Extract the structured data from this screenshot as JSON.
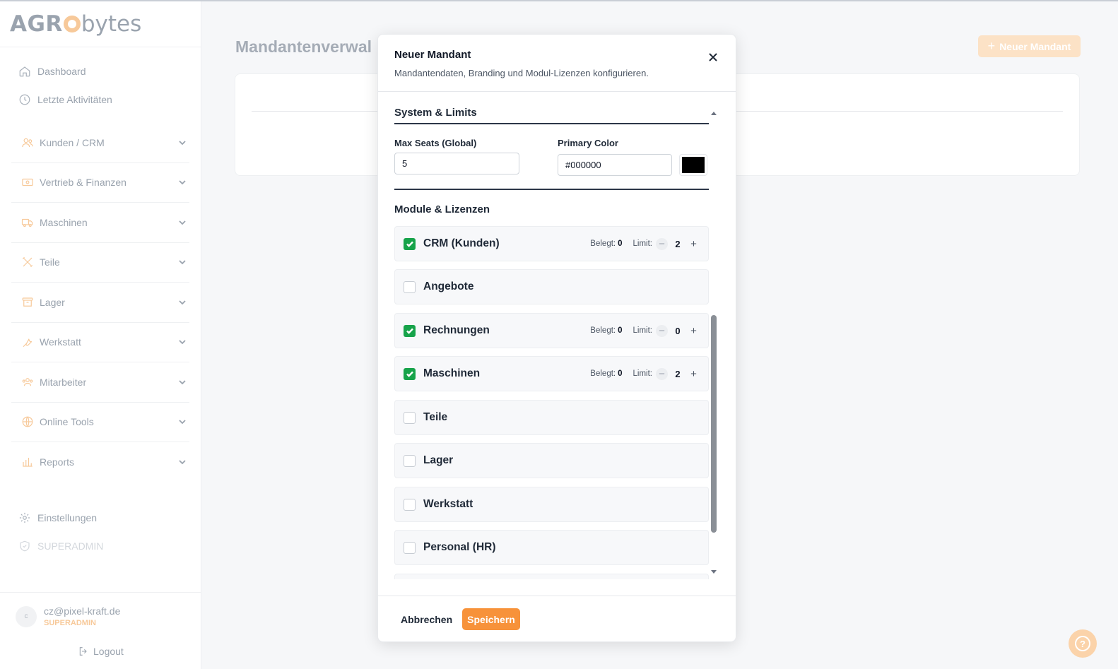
{
  "app": {
    "logo_main": "AGR",
    "logo_rest": "bytes"
  },
  "sidebar": {
    "top_links": [
      {
        "label": "Dashboard",
        "icon": "home-icon"
      },
      {
        "label": "Letzte Aktivitäten",
        "icon": "clock-icon"
      }
    ],
    "groups": [
      {
        "label": "Kunden / CRM",
        "icon": "users-icon"
      },
      {
        "label": "Vertrieb & Finanzen",
        "icon": "banknote-icon"
      },
      {
        "label": "Maschinen",
        "icon": "truck-icon"
      },
      {
        "label": "Teile",
        "icon": "tools-icon"
      },
      {
        "label": "Lager",
        "icon": "archive-icon"
      },
      {
        "label": "Werkstatt",
        "icon": "wrench-icon"
      },
      {
        "label": "Mitarbeiter",
        "icon": "team-icon"
      },
      {
        "label": "Online Tools",
        "icon": "globe-icon"
      },
      {
        "label": "Reports",
        "icon": "bar-chart-icon"
      }
    ],
    "bottom_links": [
      {
        "label": "Einstellungen",
        "icon": "gear-icon"
      },
      {
        "label": "SUPERADMIN",
        "icon": "shield-icon"
      }
    ],
    "user": {
      "initial": "c",
      "email": "cz@pixel-kraft.de",
      "role": "SUPERADMIN"
    },
    "logout_label": "Logout"
  },
  "main": {
    "title": "Mandantenverwal",
    "new_button_label": "Neuer Mandant",
    "help_symbol": "?"
  },
  "modal": {
    "title": "Neuer Mandant",
    "subtitle": "Mandantendaten, Branding und Modul-Lizenzen konfigurieren.",
    "system_section": "System & Limits",
    "max_seats_label": "Max Seats (Global)",
    "max_seats_value": "5",
    "primary_color_label": "Primary Color",
    "primary_color_value": "#000000",
    "modules_section": "Module & Lizenzen",
    "used_label": "Belegt:",
    "limit_label": "Limit:",
    "modules": [
      {
        "name": "CRM (Kunden)",
        "checked": true,
        "used": "0",
        "limit": "2"
      },
      {
        "name": "Angebote",
        "checked": false
      },
      {
        "name": "Rechnungen",
        "checked": true,
        "used": "0",
        "limit": "0"
      },
      {
        "name": "Maschinen",
        "checked": true,
        "used": "0",
        "limit": "2"
      },
      {
        "name": "Teile",
        "checked": false
      },
      {
        "name": "Lager",
        "checked": false
      },
      {
        "name": "Werkstatt",
        "checked": false
      },
      {
        "name": "Personal (HR)",
        "checked": false
      }
    ],
    "cancel_label": "Abbrechen",
    "save_label": "Speichern"
  },
  "colors": {
    "accent": "#f7923a",
    "check_green": "#16a34a",
    "swatch": "#000000"
  }
}
